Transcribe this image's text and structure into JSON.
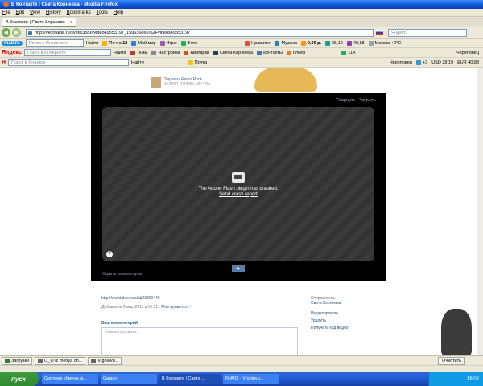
{
  "window": {
    "title": "В Контакте | Света Корнеева - Mozilla Firefox"
  },
  "menu": [
    "File",
    "Edit",
    "View",
    "History",
    "Bookmarks",
    "Tools",
    "Help"
  ],
  "tabs": [
    {
      "label": "В Контакте | Света Корнеева"
    }
  ],
  "nav": {
    "url": "http://vkontakte.ru/svetik35ru#video49553197_159636865%2Fvideos49553197",
    "search_placeholder": "Яндекс"
  },
  "toolbar_mail": {
    "brand": "mail.ru",
    "search_placeholder": "Поиск в Интернете",
    "find": "Найти",
    "items": [
      "Почта",
      "Мой мир",
      "Игры",
      "Фото",
      "Нравится",
      "Музыка"
    ],
    "mail_count": "12",
    "money": "0,00 р.",
    "rate1": "28,19",
    "rate2": "40,88",
    "city": "Москва",
    "temp": "+2°C"
  },
  "toolbar_ya1": {
    "brand": "Яндекс",
    "search_placeholder": "Поиск в Интернете",
    "find": "Найти",
    "items": [
      "Темы",
      "Настройки",
      "Аватарки",
      "Света Корнеева",
      "Контакты",
      "плеер"
    ],
    "num": "114",
    "city": "Череповец"
  },
  "toolbar_ya2": {
    "brand": "Я",
    "search_placeholder": "Поиск в Яндексе",
    "find": "Найти",
    "items": [
      "Почта"
    ],
    "city": "Череповец",
    "temp": "+3",
    "usd": "USD 28,19",
    "eur": "EUR 40,88"
  },
  "background_post": {
    "name": "Saparius Radio Rock",
    "sub": "ЗЕМЛЯ ПОЛНЫ МЕЧТЫ"
  },
  "overlay": {
    "collapse": "Свернуть",
    "close": "Закрыть",
    "crash_msg": "The Adobe Flash plugin has crashed.",
    "crash_link": "Send crash report",
    "qmark": "?",
    "next": "▶",
    "hide_comments": "Скрыть комментарии"
  },
  "info": {
    "video_link": "http://vkontakte.ru/club23800440",
    "date": "Добавлена 9 мар 2011 в 10:51",
    "like": "Мне нравится",
    "your_comment": "Ваш комментарий",
    "comment_placeholder": "Комментировать...",
    "sender_label": "Отправитель:",
    "sender_name": "Света Корнеева",
    "edit": "Редактировать",
    "delete": "Удалить",
    "embed": "Получить код видео"
  },
  "downloads": {
    "label": "Загрузки",
    "items": [
      "O_O iz menya ch...",
      "V golovu..."
    ],
    "clear": "Очистить"
  },
  "taskbar": {
    "start": "пуск",
    "tasks": [
      "Система обмена м...",
      "Galaxy",
      "В Контакте | Света ...",
      "ReMiX - V golovu..."
    ],
    "clock": "16:02"
  }
}
